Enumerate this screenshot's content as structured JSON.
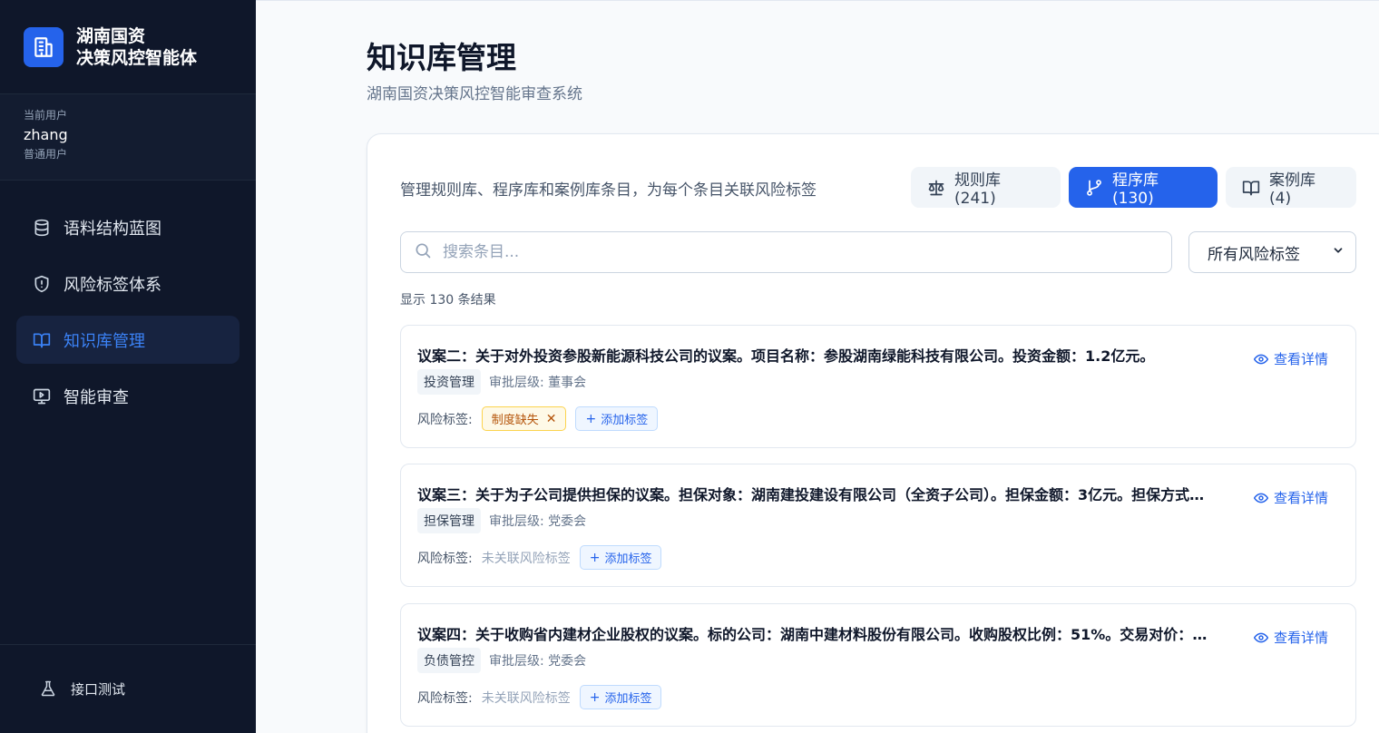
{
  "brand": {
    "line1": "湖南国资",
    "line2": "决策风控智能体"
  },
  "user": {
    "caption": "当前用户",
    "name": "zhang",
    "role": "普通用户"
  },
  "nav": {
    "items": [
      {
        "label": "语料结构蓝图",
        "icon": "database-icon"
      },
      {
        "label": "风险标签体系",
        "icon": "shield-icon"
      },
      {
        "label": "知识库管理",
        "icon": "book-icon",
        "active": true
      },
      {
        "label": "智能审查",
        "icon": "monitor-icon"
      }
    ],
    "footer": "接口测试"
  },
  "page": {
    "title": "知识库管理",
    "subtitle": "湖南国资决策风控智能审查系统"
  },
  "panel": {
    "description": "管理规则库、程序库和案例库条目，为每个条目关联风险标签",
    "tabs": [
      {
        "label": "规则库 (241)",
        "icon": "scale-icon"
      },
      {
        "label": "程序库 (130)",
        "icon": "git-branch-icon",
        "active": true
      },
      {
        "label": "案例库 (4)",
        "icon": "book-icon"
      }
    ],
    "search_placeholder": "搜索条目...",
    "filter_value": "所有风险标签",
    "result_count": "显示 130 条结果",
    "detail_label": "查看详情",
    "risk_label": "风险标签:",
    "add_tag_label": "添加标签",
    "no_tag_label": "未关联风险标签"
  },
  "items": [
    {
      "title": "议案二：关于对外投资参股新能源科技公司的议案。项目名称：参股湖南绿能科技有限公司。投资金额：1.2亿元。",
      "category": "投资管理",
      "approval": "审批层级: 董事会",
      "tag": "制度缺失"
    },
    {
      "title": "议案三：关于为子公司提供担保的议案。担保对象：湖南建投建设有限公司（全资子公司）。担保金额：3亿元。担保方式：连带责任保证。",
      "category": "担保管理",
      "approval": "审批层级: 党委会",
      "tag": ""
    },
    {
      "title": "议案四：关于收购省内建材企业股权的议案。标的公司：湖南中建材料股份有限公司。收购股权比例：51%。交易对价：待评估。",
      "category": "负债管控",
      "approval": "审批层级: 党委会",
      "tag": ""
    }
  ],
  "colors": {
    "sidebar_bg": "#0f172a",
    "accent": "#2563eb",
    "warn_tag": "#b45309"
  }
}
